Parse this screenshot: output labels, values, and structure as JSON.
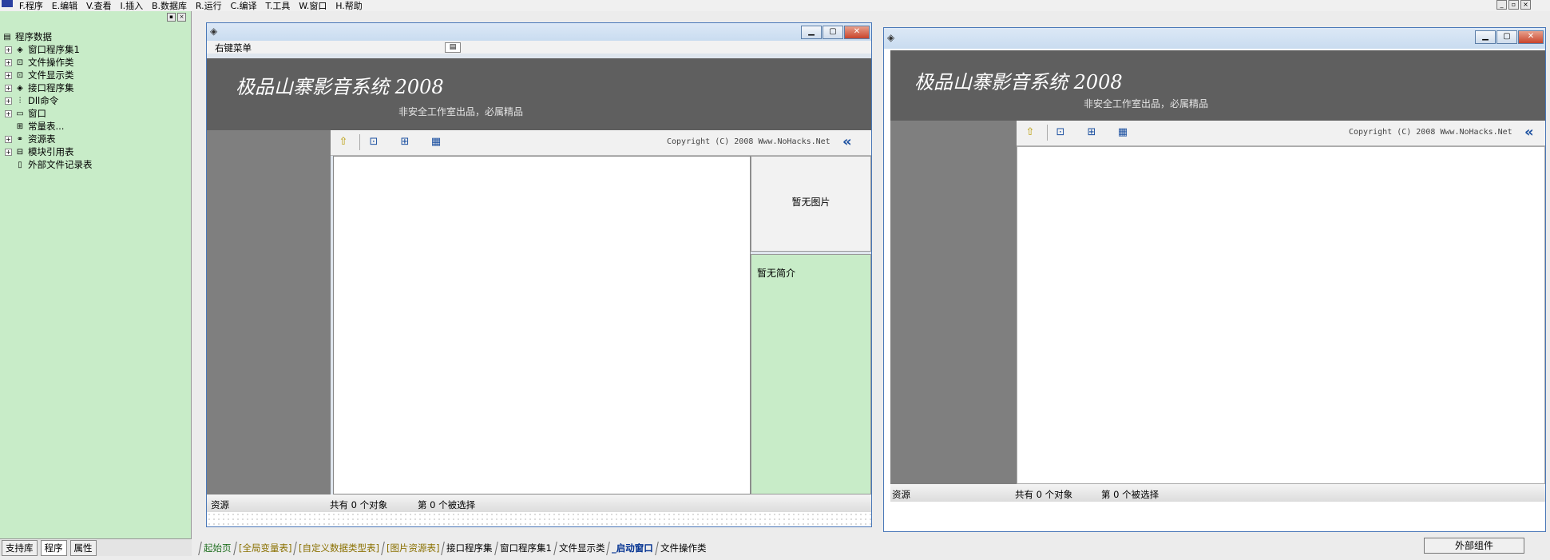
{
  "menu": {
    "items": [
      "F.程序",
      "E.编辑",
      "V.查看",
      "I.插入",
      "B.数据库",
      "R.运行",
      "C.编译",
      "T.工具",
      "W.窗口",
      "H.帮助"
    ]
  },
  "left_panel": {
    "root": "程序数据",
    "items": [
      "窗口程序集1",
      "文件操作类",
      "文件显示类",
      "接口程序集",
      "Dll命令",
      "窗口",
      "常量表...",
      "资源表",
      "模块引用表",
      "外部文件记录表"
    ],
    "tabs": [
      "支持库",
      "程序",
      "属性"
    ]
  },
  "designer": {
    "context_menu_label": "右键菜单",
    "banner_title": "极品山寨影音系统 2008",
    "banner_subtitle": "非安全工作室出品，必属精品",
    "copyright": "Copyright (C) 2008 Www.NoHacks.Net",
    "no_image": "暂无图片",
    "no_intro": "暂无简介",
    "status_resource": "资源",
    "status_total": "共有 0 个对象",
    "status_selected": "第 0 个被选择"
  },
  "preview": {
    "banner_title": "极品山寨影音系统 2008",
    "banner_subtitle": "非安全工作室出品，必属精品",
    "copyright": "Copyright (C) 2008 Www.NoHacks.Net",
    "status_resource": "资源",
    "status_total": "共有 0 个对象",
    "status_selected": "第 0 个被选择"
  },
  "doc_tabs": [
    "起始页",
    "[全局变量表]",
    "[自定义数据类型表]",
    "[图片资源表]",
    "接口程序集",
    "窗口程序集1",
    "文件显示类",
    "_启动窗口",
    "文件操作类"
  ],
  "external_components": "外部组件",
  "colors": {
    "tree_bg": "#c8ecc8",
    "banner_bg": "#5f5f5f",
    "side_bg": "#7f7f7f",
    "accent": "#1a4fa0"
  }
}
